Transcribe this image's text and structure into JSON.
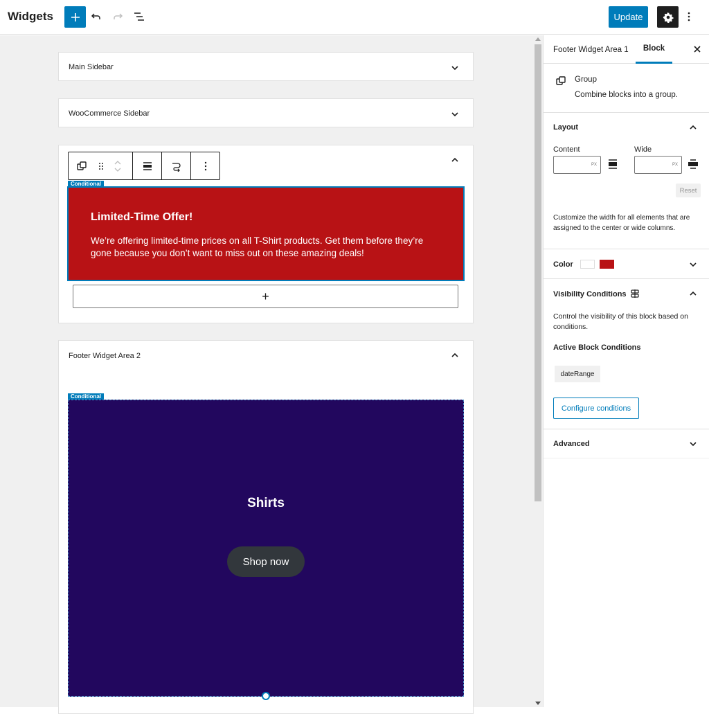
{
  "header": {
    "title": "Widgets",
    "add_icon": "plus-icon",
    "undo_icon": "undo-icon",
    "redo_icon": "redo-icon",
    "list_view_icon": "list-view-icon",
    "update_label": "Update",
    "settings_icon": "gear-icon",
    "more_icon": "more-vertical-icon"
  },
  "canvas": {
    "areas": [
      {
        "title": "Main Sidebar",
        "expanded": false
      },
      {
        "title": "WooCommerce Sidebar",
        "expanded": false
      },
      {
        "title": "Footer Widget Area 1",
        "expanded": true
      },
      {
        "title": "Footer Widget Area 2",
        "expanded": true
      }
    ],
    "block_toolbar": {
      "items": [
        "group-icon",
        "drag-handle-icon",
        "move-up-down-icon",
        "align-icon",
        "transform-icon",
        "more-options-icon"
      ]
    },
    "conditional_label": "Conditional",
    "offer_block": {
      "heading": "Limited-Time Offer!",
      "text": "We’re offering limited-time prices on all T-Shirt products. Get them before they’re gone because you don’t want to miss out on these amazing deals!",
      "background": "#b81215"
    },
    "appender_label": "+",
    "shirts_block": {
      "heading": "Shirts",
      "button_label": "Shop now",
      "background": "#22075e"
    }
  },
  "sidebar": {
    "tabs": [
      {
        "label": "Footer Widget Area 1",
        "active": false
      },
      {
        "label": "Block",
        "active": true
      }
    ],
    "close_icon": "close-icon",
    "block_card": {
      "title": "Group",
      "description": "Combine blocks into a group."
    },
    "layout": {
      "title": "Layout",
      "content_label": "Content",
      "content_value": "",
      "wide_label": "Wide",
      "wide_value": "",
      "unit": "PX",
      "reset_label": "Reset",
      "help": "Customize the width for all elements that are assigned to the center or wide columns."
    },
    "color": {
      "title": "Color",
      "text_color": "#ffffff",
      "background_color": "#b81215"
    },
    "visibility": {
      "title": "Visibility Conditions",
      "description": "Control the visibility of this block based on conditions.",
      "active_title": "Active Block Conditions",
      "conditions": [
        "dateRange"
      ],
      "configure_label": "Configure conditions"
    },
    "advanced": {
      "title": "Advanced"
    }
  }
}
